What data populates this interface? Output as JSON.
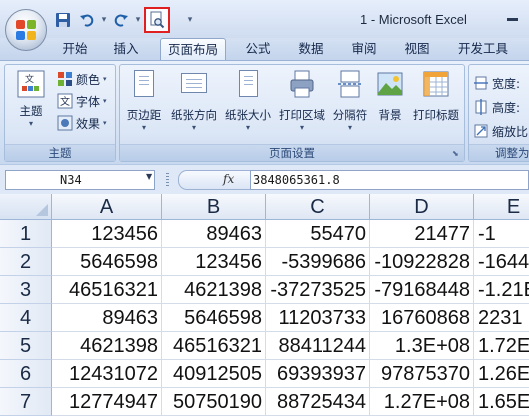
{
  "window": {
    "title": "1 - Microsoft Excel"
  },
  "quick_access": {
    "save_icon": "save-icon",
    "undo_icon": "undo-icon",
    "redo_icon": "redo-icon",
    "print_preview_icon": "print-preview-icon",
    "customize_icon": "customize-dropdown-icon"
  },
  "tabs": [
    {
      "label": "开始",
      "active": false
    },
    {
      "label": "插入",
      "active": false
    },
    {
      "label": "页面布局",
      "active": true
    },
    {
      "label": "公式",
      "active": false
    },
    {
      "label": "数据",
      "active": false
    },
    {
      "label": "审阅",
      "active": false
    },
    {
      "label": "视图",
      "active": false
    },
    {
      "label": "开发工具",
      "active": false
    }
  ],
  "ribbon": {
    "themes_group": {
      "title": "主题",
      "theme_button": "主题",
      "colors": "颜色",
      "fonts": "字体",
      "effects": "效果"
    },
    "page_setup_group": {
      "title": "页面设置",
      "margins": "页边距",
      "orientation": "纸张方向",
      "size": "纸张大小",
      "print_area": "打印区域",
      "breaks": "分隔符",
      "background": "背景",
      "print_titles": "打印标题"
    },
    "scale_group": {
      "title": "调整为",
      "width": "宽度:",
      "height": "高度:",
      "scale": "缩放比"
    }
  },
  "formula_bar": {
    "name_box": "N34",
    "fx": "fx",
    "value": "3848065361.8"
  },
  "grid": {
    "columns": [
      "A",
      "B",
      "C",
      "D",
      "E"
    ],
    "rows": [
      {
        "num": "1",
        "cells": [
          "123456",
          "89463",
          "55470",
          "21477",
          "-1"
        ]
      },
      {
        "num": "2",
        "cells": [
          "5646598",
          "123456",
          "-5399686",
          "-10922828",
          "-1644"
        ]
      },
      {
        "num": "3",
        "cells": [
          "46516321",
          "4621398",
          "-37273525",
          "-79168448",
          "-1.21E"
        ]
      },
      {
        "num": "4",
        "cells": [
          "89463",
          "5646598",
          "11203733",
          "16760868",
          "2231"
        ]
      },
      {
        "num": "5",
        "cells": [
          "4621398",
          "46516321",
          "88411244",
          "1.3E+08",
          "1.72E"
        ]
      },
      {
        "num": "6",
        "cells": [
          "12431072",
          "40912505",
          "69393937",
          "97875370",
          "1.26E"
        ]
      },
      {
        "num": "7",
        "cells": [
          "12774947",
          "50750190",
          "88725434",
          "1.27E+08",
          "1.65E"
        ]
      }
    ]
  }
}
